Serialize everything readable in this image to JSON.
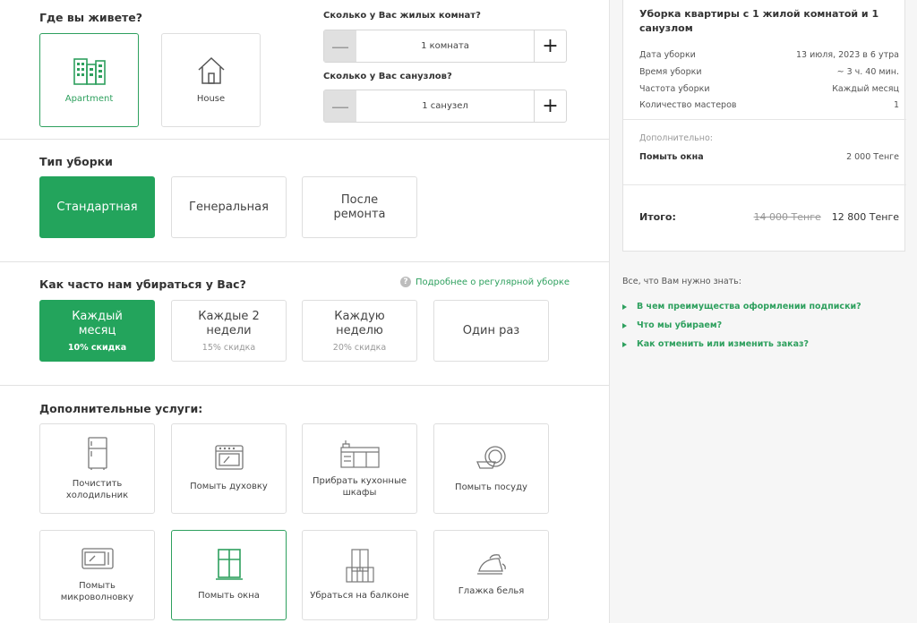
{
  "home": {
    "heading": "Где вы живете?",
    "apartment": "Apartment",
    "house": "House"
  },
  "rooms": {
    "rooms_label": "Сколько у Вас жилых комнат?",
    "rooms_value": "1 комната",
    "baths_label": "Сколько у Вас санузлов?",
    "baths_value": "1 санузел",
    "minus": "—",
    "plus": "+"
  },
  "cleaning_type": {
    "heading": "Тип уборки",
    "options": [
      "Стандартная",
      "Генеральная",
      "После ремонта"
    ]
  },
  "frequency": {
    "heading": "Как часто нам убираться у Вас?",
    "more_link": "Подробнее о регулярной уборке",
    "help_icon": "?",
    "options": [
      {
        "title": "Каждый месяц",
        "discount": "10% скидка"
      },
      {
        "title": "Каждые 2 недели",
        "discount": "15% скидка"
      },
      {
        "title": "Каждую неделю",
        "discount": "20% скидка"
      },
      {
        "title": "Один раз",
        "discount": ""
      }
    ]
  },
  "extras": {
    "heading": "Дополнительные услуги:",
    "items": [
      {
        "label": "Почистить холодильник",
        "icon": "fridge-icon"
      },
      {
        "label": "Помыть духовку",
        "icon": "oven-icon"
      },
      {
        "label": "Прибрать кухонные шкафы",
        "icon": "kitchen-cabinets-icon"
      },
      {
        "label": "Помыть посуду",
        "icon": "dishes-icon"
      },
      {
        "label": "Помыть микроволновку",
        "icon": "microwave-icon"
      },
      {
        "label": "Помыть окна",
        "icon": "window-icon"
      },
      {
        "label": "Убраться на балконе",
        "icon": "balcony-icon"
      },
      {
        "label": "Глажка белья",
        "icon": "iron-icon"
      }
    ]
  },
  "summary": {
    "title": "Уборка квартиры с 1 жилой комнатой и 1 санузлом",
    "rows": [
      {
        "k": "Дата уборки",
        "v": "13 июля, 2023 в 6 утра"
      },
      {
        "k": "Время уборки",
        "v": "~ 3 ч. 40 мин."
      },
      {
        "k": "Частота уборки",
        "v": "Каждый месяц"
      },
      {
        "k": "Количество мастеров",
        "v": "1"
      }
    ],
    "additional_label": "Дополнительно:",
    "additional": {
      "k": "Помыть окна",
      "v": "2 000 Тенге"
    },
    "total_label": "Итого:",
    "total_old": "14 000 Тенге",
    "total_new": "12 800 Тенге"
  },
  "faq": {
    "title": "Все, что Вам нужно знать:",
    "items": [
      "В чем преимущества оформлении подписки?",
      "Что мы убираем?",
      "Как отменить или изменить заказ?"
    ]
  },
  "colors": {
    "accent": "#23a45c",
    "accent_text": "#2ea05e",
    "border": "#dedede",
    "sidebar_bg": "#f6f6f6"
  }
}
